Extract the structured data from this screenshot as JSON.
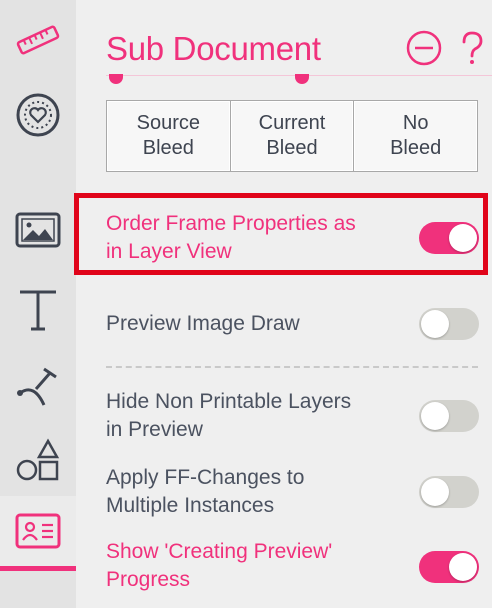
{
  "sidebar": {
    "items": [
      {
        "icon": "ruler-icon"
      },
      {
        "icon": "heart-badge-icon"
      },
      {
        "icon": "image-icon"
      },
      {
        "icon": "text-tool-icon"
      },
      {
        "icon": "pen-tool-icon"
      },
      {
        "icon": "shapes-icon"
      },
      {
        "icon": "id-card-icon",
        "active": true
      }
    ]
  },
  "panel": {
    "title": "Sub Document",
    "header_buttons": {
      "collapse": "minus-circle-icon",
      "help": "question-icon"
    }
  },
  "bleed": {
    "options": [
      {
        "line1": "Source",
        "line2": "Bleed"
      },
      {
        "line1": "Current",
        "line2": "Bleed"
      },
      {
        "line1": "No",
        "line2": "Bleed"
      }
    ]
  },
  "settings": [
    {
      "line1": "Order Frame Properties as",
      "line2": "in Layer View",
      "enabled": true,
      "highlighted": true
    },
    {
      "line1": "Preview Image Draw",
      "line2": "",
      "enabled": false
    },
    {
      "line1": "Hide Non Printable Layers",
      "line2": "in Preview",
      "enabled": false
    },
    {
      "line1": "Apply FF-Changes to",
      "line2": "Multiple Instances",
      "enabled": false
    },
    {
      "line1": "Show 'Creating Preview'",
      "line2": "Progress",
      "enabled": true
    }
  ],
  "colors": {
    "accent": "#f0317c",
    "highlight": "#e0041a",
    "text": "#4b5260",
    "toggle_off": "#d2d2cd"
  }
}
